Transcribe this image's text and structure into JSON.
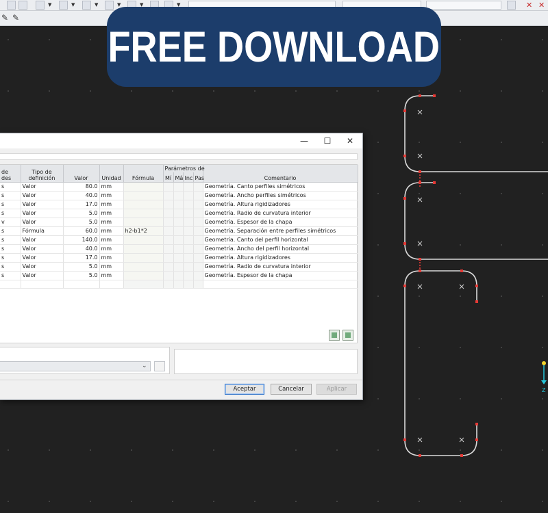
{
  "banner": {
    "text": "FREE DOWNLOAD"
  },
  "colors": {
    "canvas": "#212121",
    "banner": "#1c3d6b",
    "node": "#e53935",
    "line": "#d9d9d9",
    "accent_yellow": "#f2d22c",
    "accent_cyan": "#26c6da"
  },
  "dialog": {
    "window_buttons": {
      "minimize": "—",
      "maximize": "☐",
      "close": "✕"
    },
    "table": {
      "headers": {
        "col0": "de des",
        "tipo": "Tipo de definición",
        "valor": "Valor",
        "unidad": "Unidad",
        "formula": "Fórmula",
        "params_group": "Parámetros de",
        "p1": "Mí",
        "p2": "Má",
        "p3": "Inc",
        "p4": "Pas",
        "comentario": "Comentario"
      },
      "rows": [
        {
          "c0": "s",
          "tipo": "Valor",
          "valor": "80.0",
          "unidad": "mm",
          "formula": "",
          "comentario": "Geometría. Canto perfiles simétricos"
        },
        {
          "c0": "s",
          "tipo": "Valor",
          "valor": "40.0",
          "unidad": "mm",
          "formula": "",
          "comentario": "Geometría. Ancho perfiles simétricos"
        },
        {
          "c0": "s",
          "tipo": "Valor",
          "valor": "17.0",
          "unidad": "mm",
          "formula": "",
          "comentario": "Geometría. Altura rigidizadores"
        },
        {
          "c0": "s",
          "tipo": "Valor",
          "valor": "5.0",
          "unidad": "mm",
          "formula": "",
          "comentario": "Geometría. Radio de curvatura interior"
        },
        {
          "c0": "v",
          "tipo": "Valor",
          "valor": "5.0",
          "unidad": "mm",
          "formula": "",
          "comentario": "Geometría. Espesor de la chapa"
        },
        {
          "c0": "s",
          "tipo": "Fórmula",
          "valor": "60.0",
          "unidad": "mm",
          "formula": "h2-b1*2",
          "comentario": "Geometría. Separación entre perfiles simétricos"
        },
        {
          "c0": "s",
          "tipo": "Valor",
          "valor": "140.0",
          "unidad": "mm",
          "formula": "",
          "comentario": "Geometría. Canto del perfil horizontal"
        },
        {
          "c0": "s",
          "tipo": "Valor",
          "valor": "40.0",
          "unidad": "mm",
          "formula": "",
          "comentario": "Geometría. Ancho del perfil horizontal"
        },
        {
          "c0": "s",
          "tipo": "Valor",
          "valor": "17.0",
          "unidad": "mm",
          "formula": "",
          "comentario": "Geometría. Altura rigidizadores"
        },
        {
          "c0": "s",
          "tipo": "Valor",
          "valor": "5.0",
          "unidad": "mm",
          "formula": "",
          "comentario": "Geometría. Radio de curvatura interior"
        },
        {
          "c0": "s",
          "tipo": "Valor",
          "valor": "5.0",
          "unidad": "mm",
          "formula": "",
          "comentario": "Geometría. Espesor de la chapa"
        }
      ]
    },
    "buttons": {
      "accept": "Aceptar",
      "cancel": "Cancelar",
      "apply": "Aplicar"
    }
  },
  "canvas": {
    "axis_label": "Z"
  }
}
